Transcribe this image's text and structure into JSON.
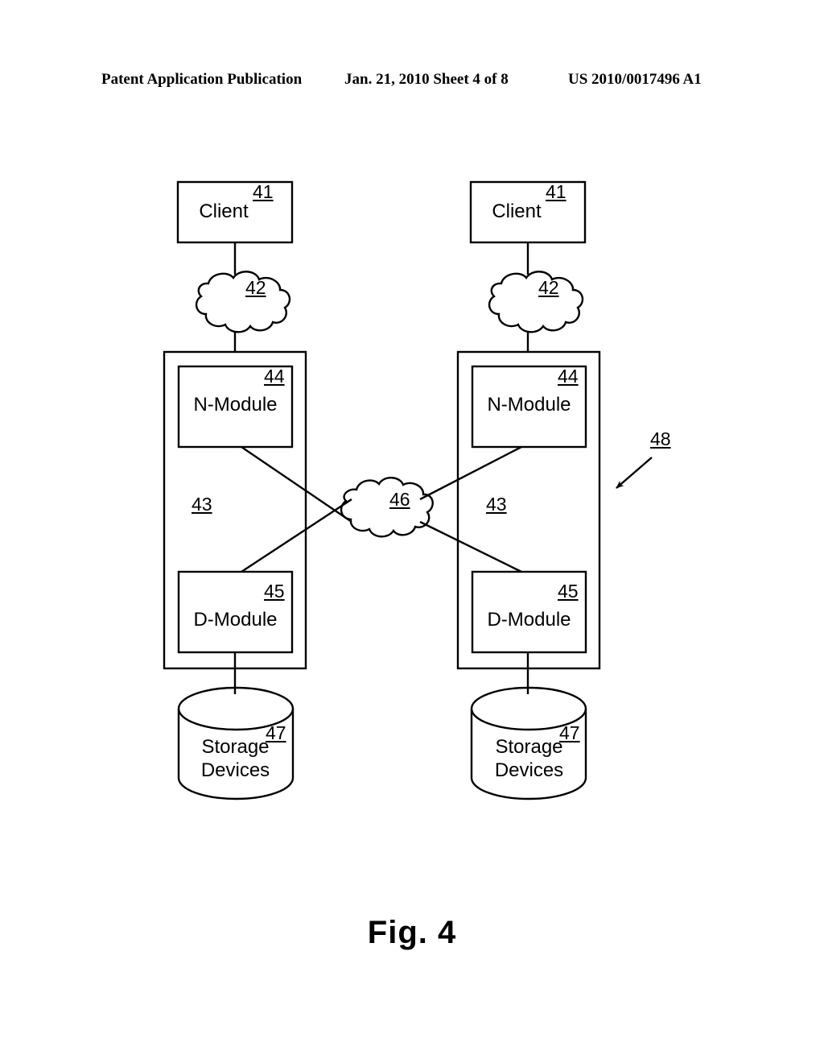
{
  "page_header": {
    "left": "Patent Application Publication",
    "middle": "Jan. 21, 2010  Sheet 4 of 8",
    "right": "US 2010/0017496 A1"
  },
  "figure": {
    "caption": "Fig. 4",
    "system_ref": "48",
    "columns": [
      {
        "side": "left",
        "client": {
          "label": "Client",
          "ref": "41"
        },
        "client_cloud": {
          "ref": "42"
        },
        "node": {
          "ref": "43"
        },
        "n_module": {
          "label": "N-Module",
          "ref": "44"
        },
        "d_module": {
          "label": "D-Module",
          "ref": "45"
        },
        "storage": {
          "line1": "Storage",
          "line2": "Devices",
          "ref": "47"
        }
      },
      {
        "side": "right",
        "client": {
          "label": "Client",
          "ref": "41"
        },
        "client_cloud": {
          "ref": "42"
        },
        "node": {
          "ref": "43"
        },
        "n_module": {
          "label": "N-Module",
          "ref": "44"
        },
        "d_module": {
          "label": "D-Module",
          "ref": "45"
        },
        "storage": {
          "line1": "Storage",
          "line2": "Devices",
          "ref": "47"
        }
      }
    ],
    "switching_fabric": {
      "ref": "46"
    }
  },
  "colors": {
    "ink": "#000000",
    "paper": "#ffffff"
  }
}
